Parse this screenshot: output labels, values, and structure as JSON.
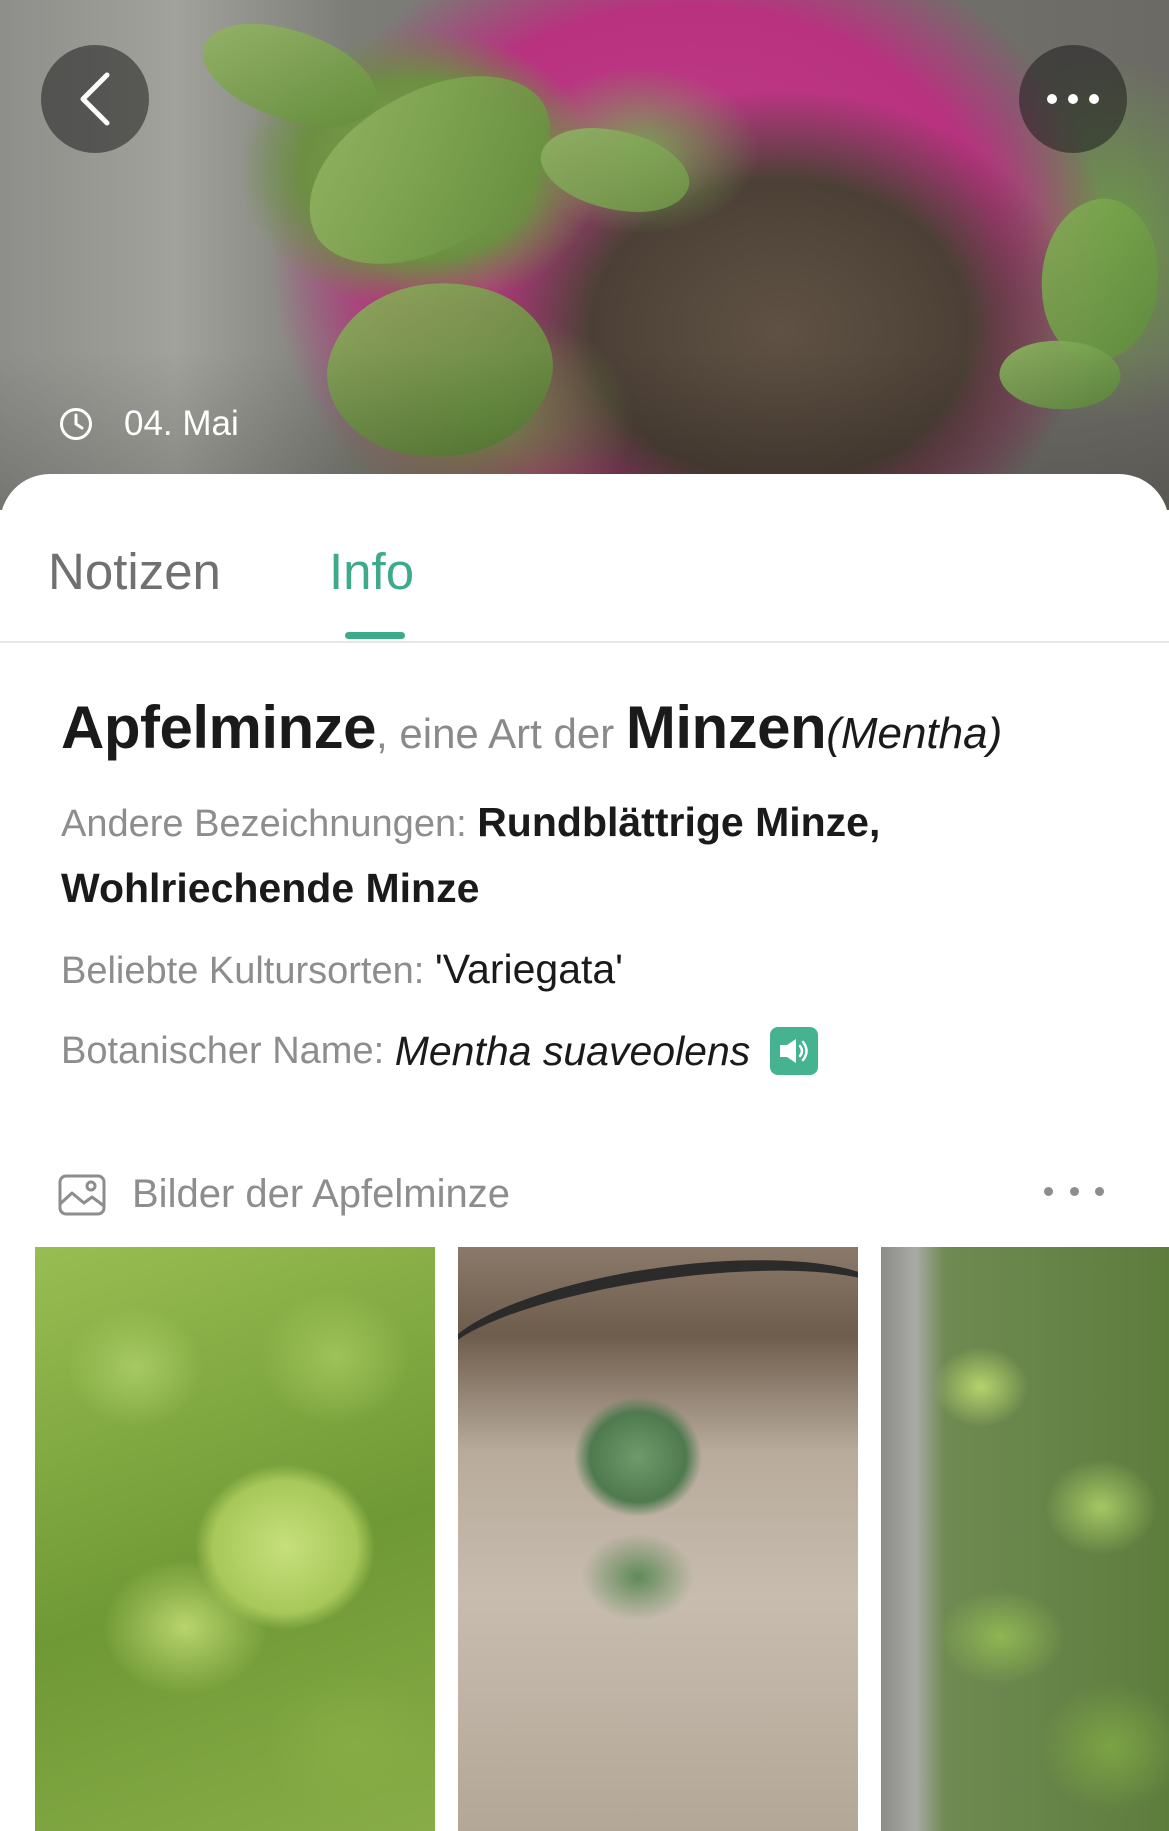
{
  "header": {
    "date": "04. Mai",
    "back_icon": "chevron-left-icon",
    "more_icon": "more-dots-icon",
    "clock_icon": "clock-icon"
  },
  "tabs": [
    {
      "label": "Notizen",
      "active": false
    },
    {
      "label": "Info",
      "active": true
    }
  ],
  "colors": {
    "accent": "#3dab8a",
    "label_gray": "#8d8d8d",
    "text_dark": "#1a1a1a"
  },
  "info": {
    "plant_name": "Apfelminze",
    "species_of": ", eine Art der ",
    "genus": "Minzen",
    "genus_latin": "(Mentha)",
    "other_names_label": "Andere Bezeichnungen: ",
    "other_names": "Rundblättrige Minze, Wohlriechende Minze",
    "cultivars_label": "Beliebte Kultursorten: ",
    "cultivars": "'Variegata'",
    "botanical_label": "Botanischer Name: ",
    "botanical_name": "Mentha suaveolens",
    "speaker_icon": "speaker-icon"
  },
  "gallery": {
    "title": "Bilder der Apfelminze",
    "icon": "image-icon",
    "more_icon": "more-dots-icon",
    "thumbnails": 3
  }
}
